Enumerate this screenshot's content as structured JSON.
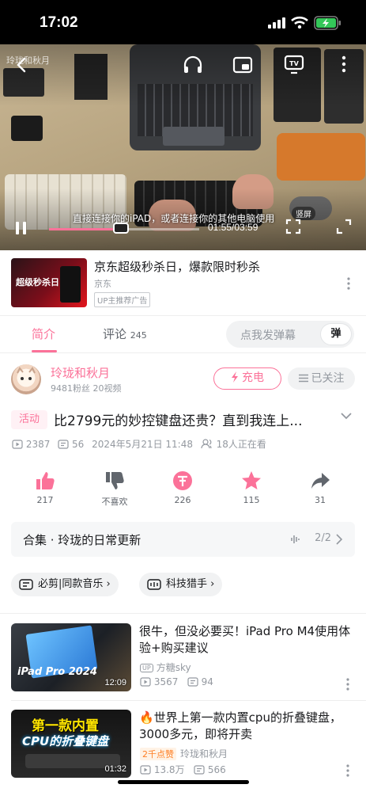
{
  "status_bar": {
    "time": "17:02"
  },
  "player": {
    "watermark": "玲珑和秋月",
    "subtitle": "直接连接你的iPAD，或者连接你的其他电脑使用",
    "time": "01:55/03:59",
    "progress": 0.48,
    "vertical_label": "竖屏"
  },
  "ad": {
    "title": "京东超级秒杀日，爆款限时秒杀",
    "advertiser": "京东",
    "tag": "UP主推荐广告",
    "thumb_text": "超级秒杀日"
  },
  "tabs": {
    "intro": "简介",
    "comments": "评论",
    "comment_count": "245",
    "danmaku_placeholder": "点我发弹幕",
    "danmaku_button": "弹"
  },
  "uploader": {
    "name": "玲珑和秋月",
    "stats": "9481粉丝  20视频",
    "charge": "充电",
    "follow": "已关注"
  },
  "video": {
    "activity_tag": "活动",
    "title": "比2799元的妙控键盘还贵？直到我连上...",
    "views": "2387",
    "danmaku": "56",
    "date": "2024年5月21日 11:48",
    "watching": "18人正在看"
  },
  "actions": {
    "like": "217",
    "dislike": "不喜欢",
    "coin": "226",
    "favorite": "115",
    "share": "31"
  },
  "collection": {
    "title": "合集 · 玲珑的日常更新",
    "count": "2/2"
  },
  "chips": [
    "必剪|同款音乐",
    "科技猎手"
  ],
  "recommendations": [
    {
      "title": "很牛，但没必要买！iPad Pro M4使用体验+购买建议",
      "author": "方糖sky",
      "views": "3567",
      "danmaku": "94",
      "duration": "12:09",
      "thumb_text": "iPad Pro 2024"
    },
    {
      "title": "🔥世界上第一款内置cpu的折叠键盘，3000多元，即将开卖",
      "badge": "2千点赞",
      "author": "玲珑和秋月",
      "views": "13.8万",
      "danmaku": "566",
      "duration": "01:32",
      "thumb_line1": "第一款内置",
      "thumb_line2": "CPU的折叠键盘"
    }
  ],
  "colors": {
    "accent": "#fb7299",
    "muted": "#9499a0"
  }
}
